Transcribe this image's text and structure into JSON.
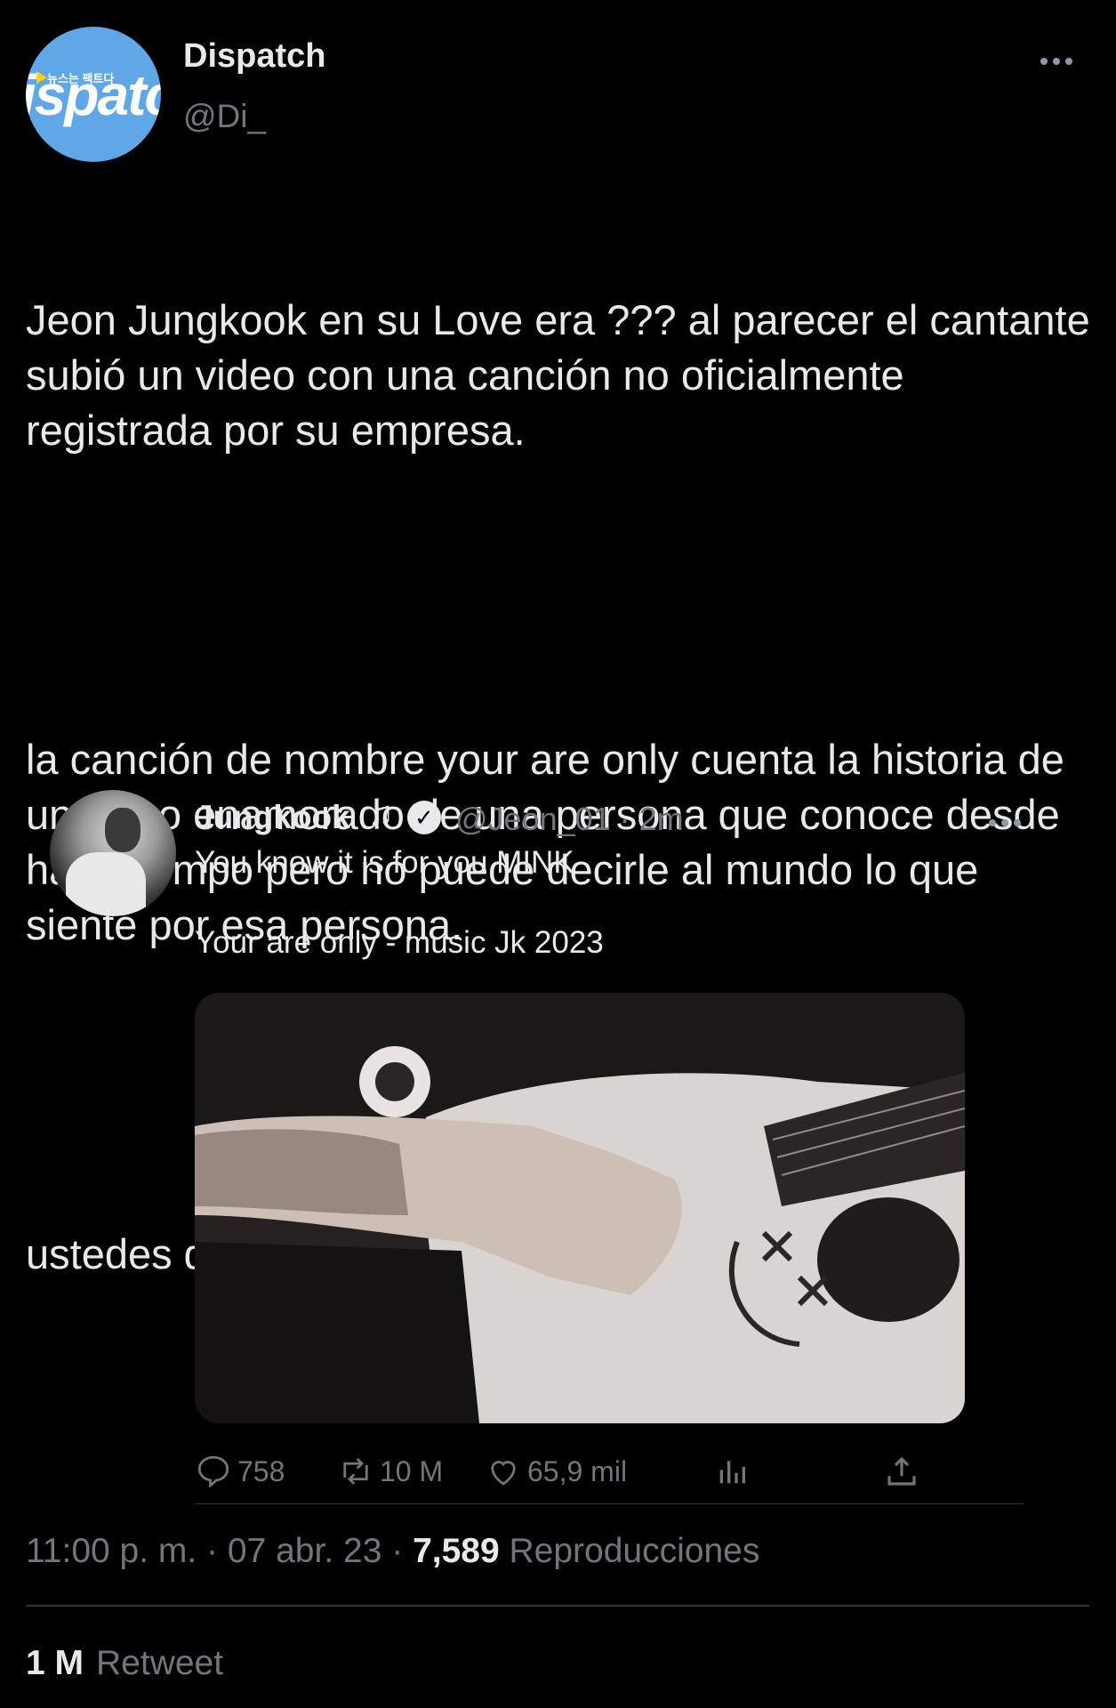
{
  "author": {
    "name": "Dispatch",
    "handle": "@Di_",
    "avatar_text": "ispatc",
    "avatar_small_text": "뉴스는 팩트다",
    "avatar_color": "#5fa7e6"
  },
  "tweet": {
    "paragraphs": [
      "Jeon Jungkook en su Love era ??? al parecer el cantante subió un video con una canción no oficialmente registrada por su empresa.",
      "la canción de nombre your are only cuenta la historia de un chico enamorado de una persona que conoce desde hace tiempo pero no puede decirle al mundo lo que siente por esa persona.",
      "ustedes que creen ??!! 😱😱😱😱😱😱"
    ]
  },
  "quoted": {
    "name": "Jungkook",
    "name_suffix": "♫",
    "handle_time": "@Jeon_01 · 2m",
    "line1": "You know it is for you MINK",
    "line2": "Your are only - music Jk 2023",
    "media_icon": "guitar-photo",
    "actions": {
      "replies": "758",
      "retweets": "10 M",
      "likes": "65,9 mil"
    }
  },
  "meta": {
    "time": "11:00 p. m.",
    "date": "07 abr. 23",
    "views": "7,589",
    "views_label": "Reproducciones"
  },
  "stats": {
    "retweets": "1 M",
    "retweets_label": "Retweet"
  },
  "colors": {
    "background": "#000000",
    "text": "#e7e9ea",
    "secondary": "#71767b",
    "divider": "#2f3336"
  }
}
